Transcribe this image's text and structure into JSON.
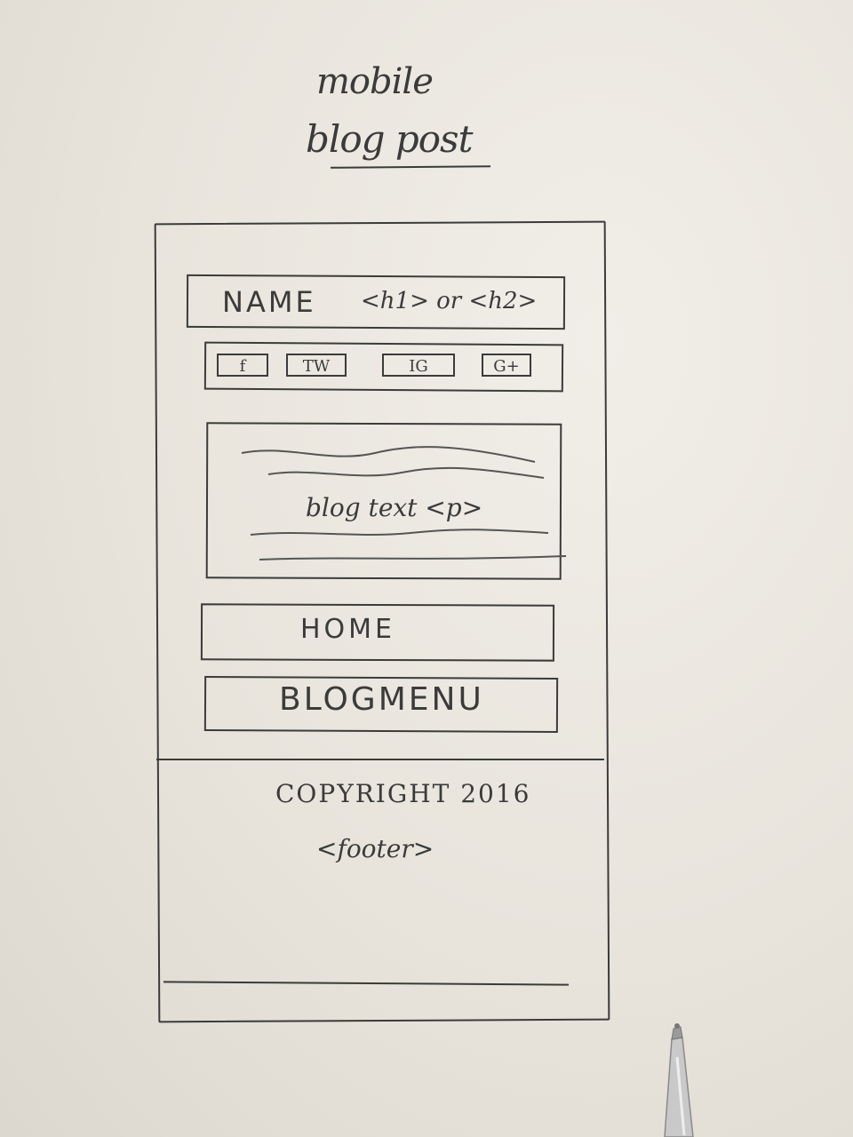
{
  "sheet": {
    "title_line1": "mobile",
    "title_line2": "blog post"
  },
  "header": {
    "name": "NAME",
    "heading_tags": "<h1> or <h2>"
  },
  "social": {
    "buttons": [
      "f",
      "TW",
      "IG",
      "G+"
    ]
  },
  "content": {
    "text": "blog text <p>"
  },
  "nav": {
    "home": "HOME",
    "blog_menu": "BLOGMENU"
  },
  "footer": {
    "copyright": "COPYRIGHT 2016",
    "tag": "<footer>"
  },
  "colors": {
    "ink": "#3b3b3b",
    "paper": "#ebe8e1"
  }
}
